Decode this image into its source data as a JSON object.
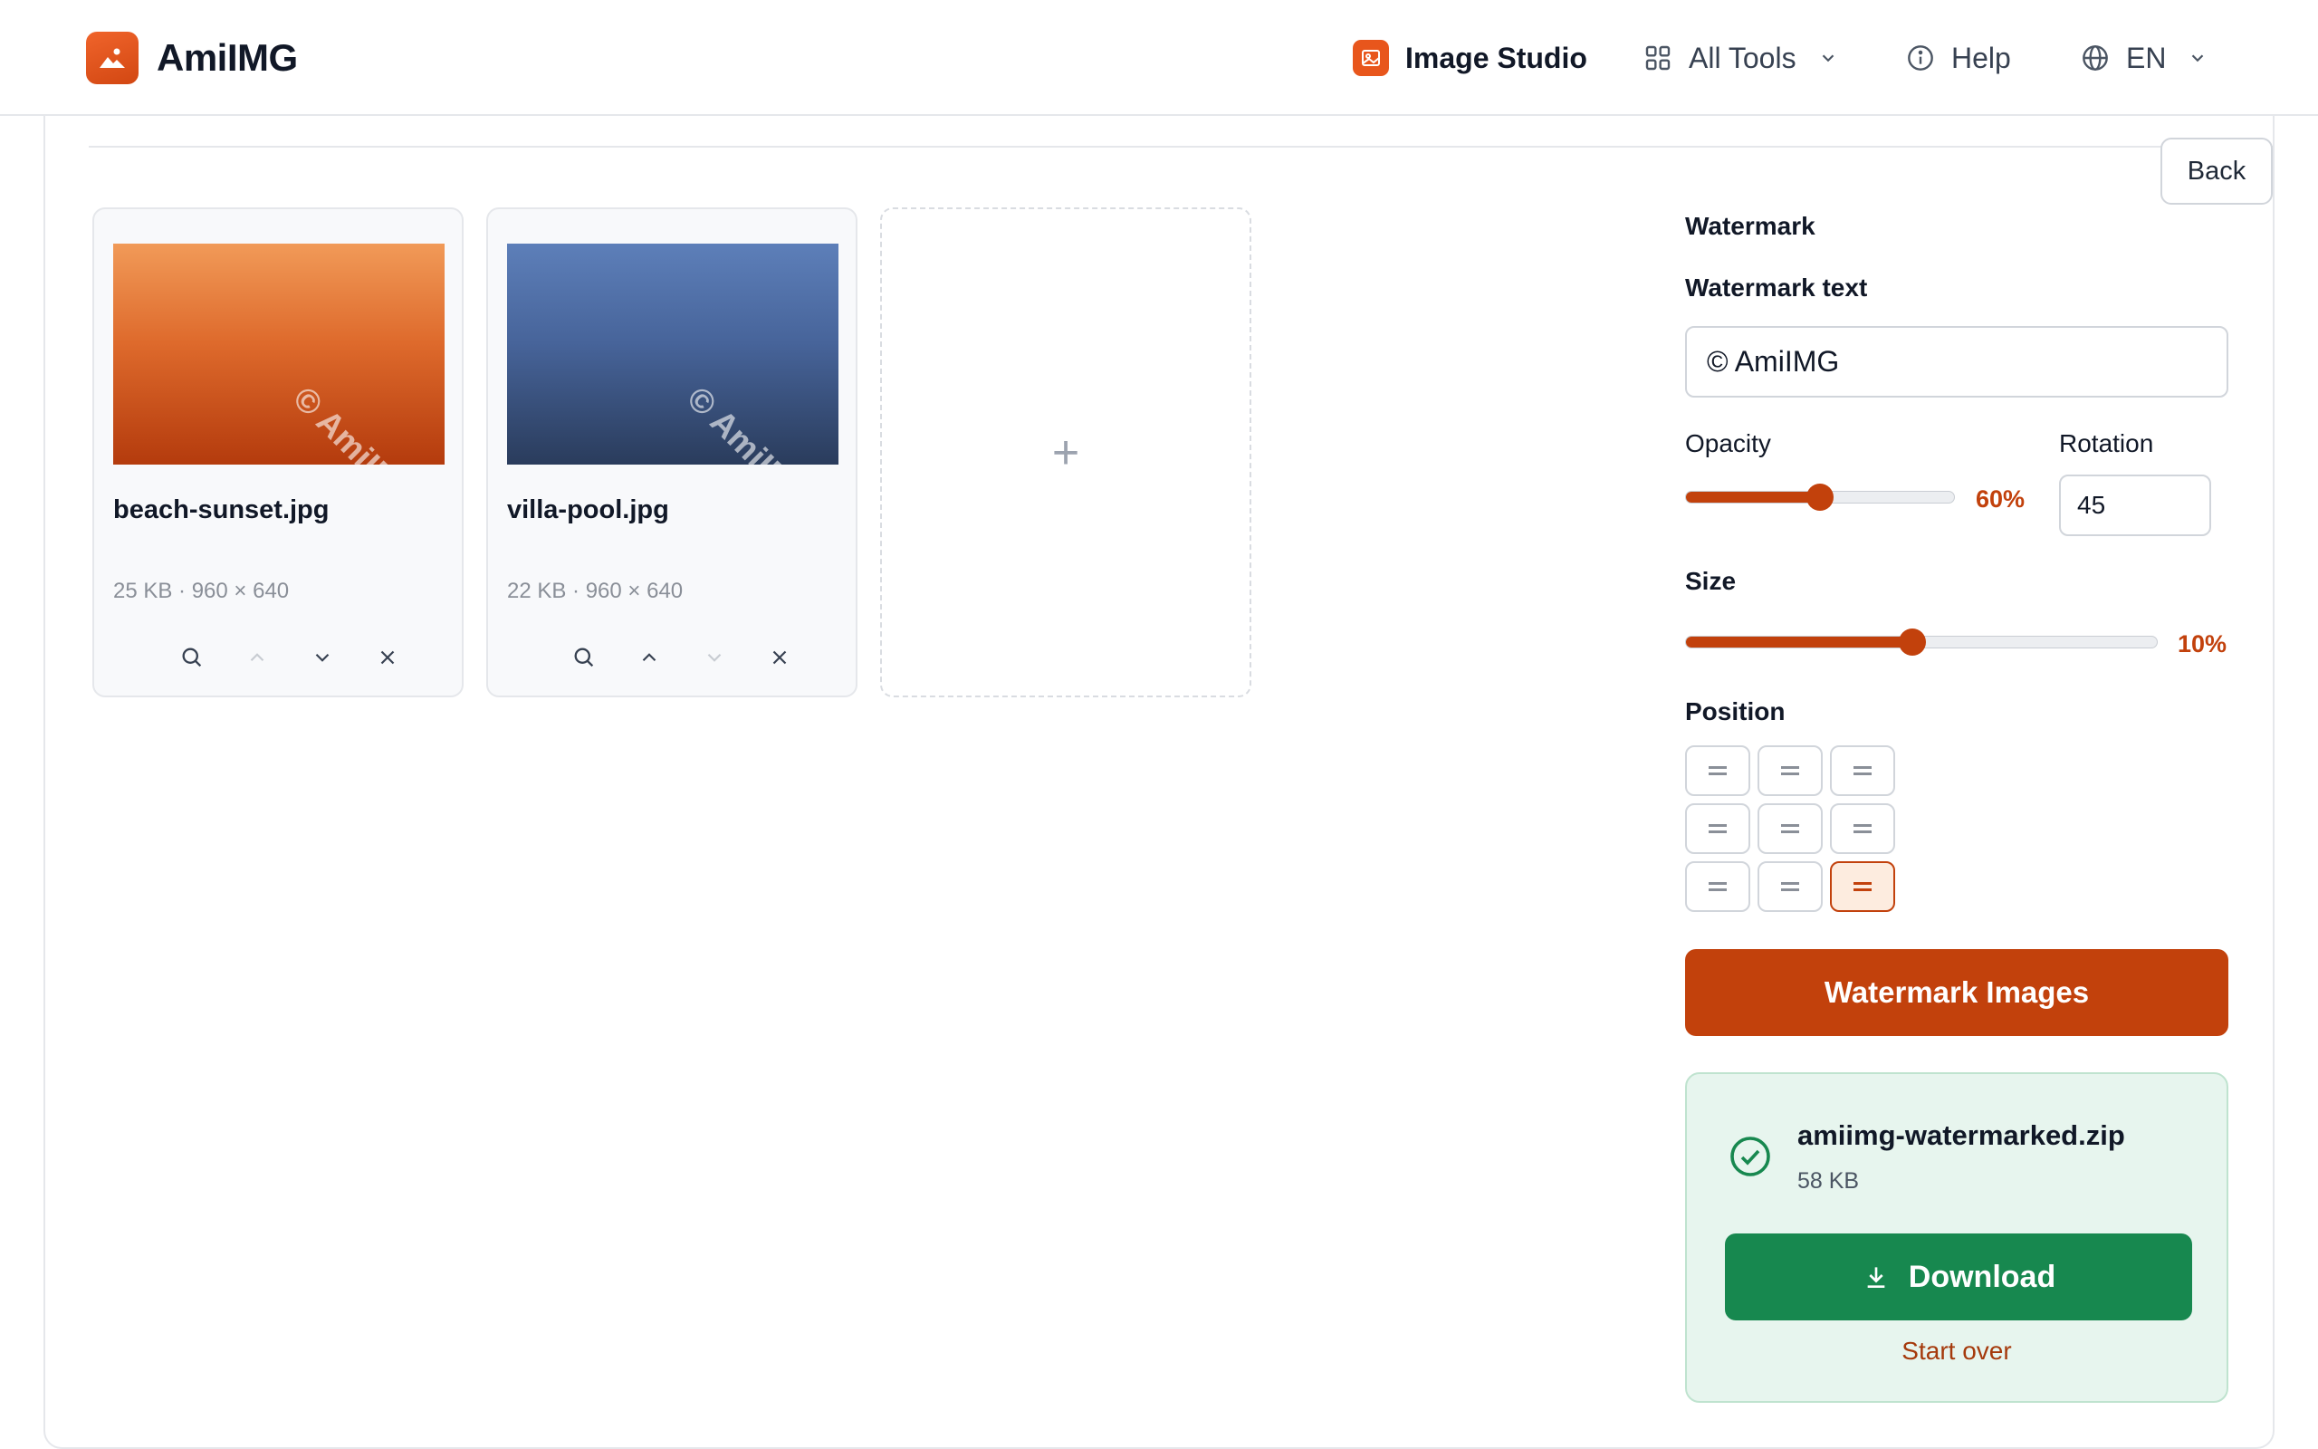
{
  "header": {
    "brand": "AmiIMG",
    "nav": {
      "studio": "Image Studio",
      "tools": "All Tools",
      "help": "Help",
      "lang": "EN"
    }
  },
  "back_label": "Back",
  "files": [
    {
      "name": "beach-sunset.jpg",
      "meta": "25 KB · 960 × 640",
      "watermark": "© AmiIMG"
    },
    {
      "name": "villa-pool.jpg",
      "meta": "22 KB · 960 × 640",
      "watermark": "© AmiIMG"
    }
  ],
  "add_label": "+",
  "panel": {
    "section_title": "Watermark",
    "text_label": "Watermark text",
    "text_value": "© AmiIMG",
    "opacity_label": "Opacity",
    "opacity_value": "60%",
    "opacity_level": 0.5,
    "rotation_label": "Rotation",
    "rotation_value": "45",
    "size_label": "Size",
    "size_value": "10%",
    "size_level": 0.48,
    "position_label": "Position",
    "position_selected": "bottom-right",
    "submit_label": "Watermark Images"
  },
  "result": {
    "file_name": "amiimg-watermarked.zip",
    "file_size": "58 KB",
    "download_label": "Download",
    "start_over_label": "Start over"
  },
  "colors": {
    "accent": "#c2410c",
    "success": "#17884f",
    "success_bg": "#e7f5ee"
  }
}
